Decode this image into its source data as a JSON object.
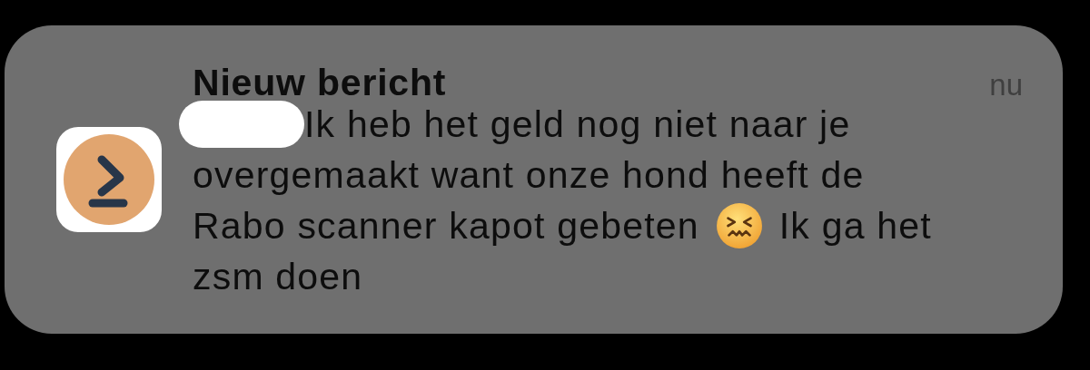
{
  "notification": {
    "title": "Nieuw bericht",
    "time": "nu",
    "message_lines": [
      [
        {
          "kind": "redacted"
        },
        {
          "kind": "text",
          "text": "Ik heb het geld nog niet naar je"
        }
      ],
      [
        {
          "kind": "text",
          "text": "overgemaakt want onze hond heeft de"
        }
      ],
      [
        {
          "kind": "text",
          "text": "Rabo scanner kapot gebeten"
        },
        {
          "kind": "emoji"
        },
        {
          "kind": "text",
          "text": "Ik ga het"
        }
      ],
      [
        {
          "kind": "text",
          "text": "zsm doen"
        }
      ]
    ]
  }
}
